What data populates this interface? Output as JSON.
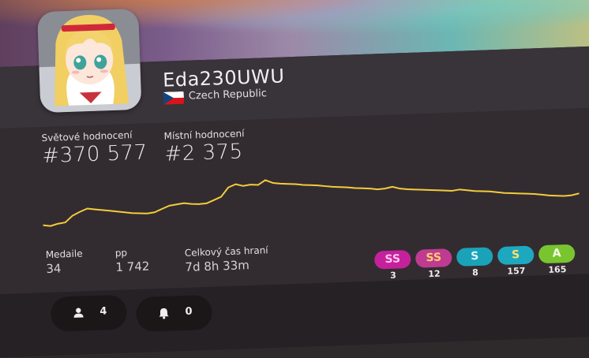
{
  "profile": {
    "username": "Eda230UWU",
    "country": "Czech Republic"
  },
  "ranks": {
    "global_label": "Světové hodnocení",
    "global_value": "#370 577",
    "country_label": "Místní hodnocení",
    "country_value": "#2 375"
  },
  "stats": {
    "medals_label": "Medaile",
    "medals_value": "34",
    "pp_label": "pp",
    "pp_value": "1 742",
    "playtime_label": "Celkový čas hraní",
    "playtime_value": "7d 8h 33m"
  },
  "rank_history": [
    0.18,
    0.16,
    0.2,
    0.22,
    0.35,
    0.42,
    0.48,
    0.46,
    0.44,
    0.42,
    0.4,
    0.38,
    0.36,
    0.35,
    0.34,
    0.36,
    0.42,
    0.48,
    0.5,
    0.52,
    0.5,
    0.49,
    0.5,
    0.56,
    0.62,
    0.8,
    0.86,
    0.82,
    0.84,
    0.83,
    0.92,
    0.86,
    0.84,
    0.83,
    0.82,
    0.8,
    0.79,
    0.78,
    0.76,
    0.74,
    0.73,
    0.72,
    0.7,
    0.69,
    0.68,
    0.66,
    0.67,
    0.7,
    0.66,
    0.64,
    0.63,
    0.62,
    0.61,
    0.6,
    0.59,
    0.58,
    0.6,
    0.58,
    0.56,
    0.55,
    0.54,
    0.52,
    0.5,
    0.49,
    0.48,
    0.47,
    0.46,
    0.44,
    0.42,
    0.41,
    0.4,
    0.41,
    0.44
  ],
  "graph_color": "#f4cc3a",
  "grades": [
    {
      "label": "SS",
      "count": "3",
      "bg": "#c6219d",
      "fg": "#ffc7ee"
    },
    {
      "label": "SS",
      "count": "12",
      "bg": "#bf3b91",
      "fg": "#ffd06a"
    },
    {
      "label": "S",
      "count": "8",
      "bg": "#1aa3b8",
      "fg": "#dff8ff"
    },
    {
      "label": "S",
      "count": "157",
      "bg": "#1ea8c0",
      "fg": "#ffe06b"
    },
    {
      "label": "A",
      "count": "165",
      "bg": "#79c52f",
      "fg": "#f4ffe6"
    }
  ],
  "social": {
    "friends_count": "4",
    "notifications_count": "0"
  }
}
